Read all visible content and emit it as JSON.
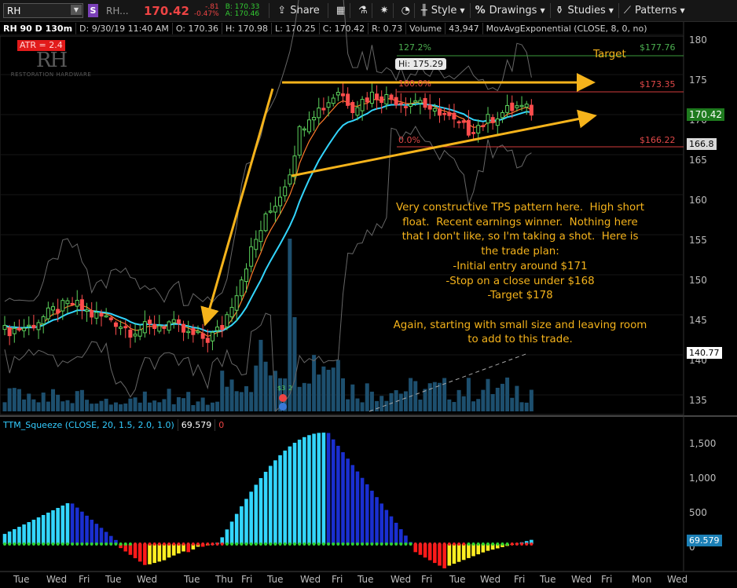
{
  "toolbar": {
    "symbol": "RH",
    "symbol_badge": "S",
    "name": "RH...",
    "last": "170.42",
    "change": "-.81",
    "change_pct": "-0.47%",
    "bid": "B: 170.33",
    "ask": "A: 170.46",
    "share": "Share",
    "style": "Style",
    "drawings": "Drawings",
    "studies": "Studies",
    "patterns": "Patterns"
  },
  "info": {
    "desc": "RH 90 D 130m",
    "datetime": "D: 9/30/19 11:40 AM",
    "open": "O: 170.36",
    "high": "H: 170.98",
    "low": "L: 170.25",
    "close": "C: 170.42",
    "range": "R: 0.73",
    "volume_label": "Volume",
    "volume": "43,947",
    "ema": "MovAvgExponential (CLOSE, 8, 0, no)"
  },
  "atr_badge": "ATR = 2.4",
  "logo": {
    "mark": "RH",
    "text": "RESTORATION HARDWARE"
  },
  "price_axis": [
    "180",
    "175",
    "170",
    "165",
    "160",
    "155",
    "150",
    "145",
    "140",
    "135"
  ],
  "price_tags": {
    "last": "170.42",
    "level_166": "166.8",
    "level_140": "140.77"
  },
  "fib": {
    "ext": "127.2%",
    "top": "100.0%",
    "zero": "0.0%"
  },
  "hi_tag": "Hi: 175.29",
  "levels": {
    "target_price": "$177.76",
    "resistance": "$173.35",
    "support": "$166.22",
    "target_word": "Target"
  },
  "volume_markers": [
    "$3",
    "2"
  ],
  "note_lines": [
    "Very constructive TPS pattern here.  High short",
    "float.  Recent earnings winner.  Nothing here",
    "that I don't like, so I'm taking a shot.  Here is",
    "the trade plan:",
    "-Initial entry around $171",
    "-Stop on a close under $168",
    "-Target $178",
    "",
    "Again, starting with small size and leaving room",
    "to add to this trade."
  ],
  "squeeze": {
    "name": "TTM_Squeeze (CLOSE, 20, 1.5, 2.0, 1.0)",
    "value": "69.579",
    "zero": "0",
    "tag": "69.579"
  },
  "squeeze_axis": [
    "1,500",
    "1,000",
    "500",
    "0"
  ],
  "x_axis": [
    "Tue",
    "Wed",
    "Fri",
    "Tue",
    "Wed",
    "Tue",
    "Thu",
    "Fri",
    "Tue",
    "Wed",
    "Fri",
    "Tue",
    "Wed",
    "Fri",
    "Tue",
    "Wed",
    "Fri",
    "Tue",
    "Wed",
    "Fri",
    "Mon",
    "Wed"
  ],
  "colors": {
    "up": "#5cd15c",
    "down": "#ff4d4d",
    "cyan": "#33d6ff",
    "blue": "#1a2fd0",
    "red": "#ff1a1a",
    "yellow": "#ffee22",
    "annot": "#f5b31b",
    "ema": "#ff7b2a"
  }
}
